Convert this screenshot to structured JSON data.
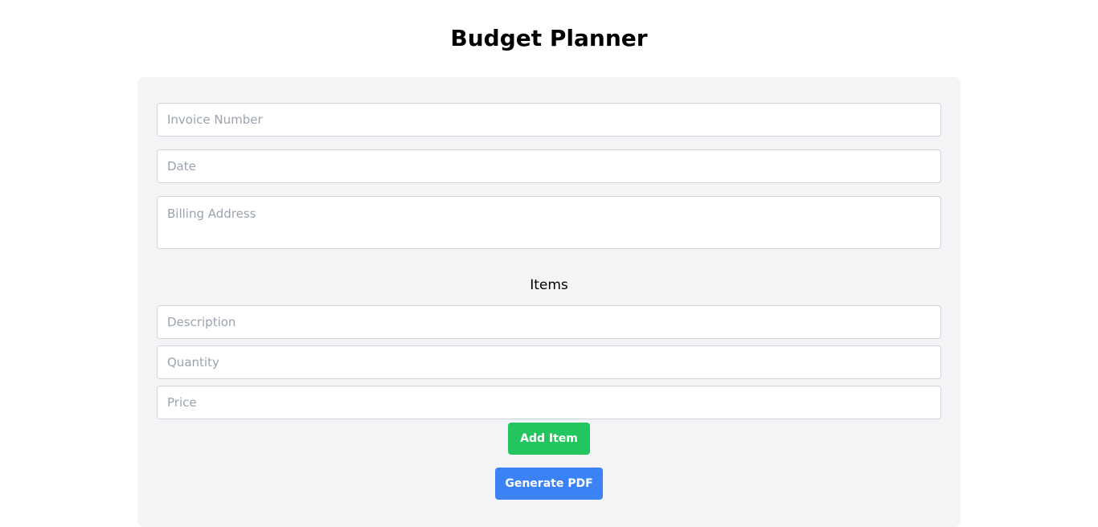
{
  "header": {
    "title": "Budget Planner"
  },
  "form": {
    "invoice_number": {
      "placeholder": "Invoice Number",
      "value": ""
    },
    "date": {
      "placeholder": "Date",
      "value": ""
    },
    "billing_address": {
      "placeholder": "Billing Address",
      "value": ""
    }
  },
  "items_section": {
    "title": "Items",
    "description": {
      "placeholder": "Description",
      "value": ""
    },
    "quantity": {
      "placeholder": "Quantity",
      "value": ""
    },
    "price": {
      "placeholder": "Price",
      "value": ""
    },
    "add_item_label": "Add Item"
  },
  "actions": {
    "generate_pdf_label": "Generate PDF"
  },
  "colors": {
    "panel_background": "#f3f4f6",
    "add_button": "#22c55e",
    "generate_button": "#3b82f6",
    "placeholder_text": "#9ca3af",
    "field_border": "#d1d5db"
  }
}
